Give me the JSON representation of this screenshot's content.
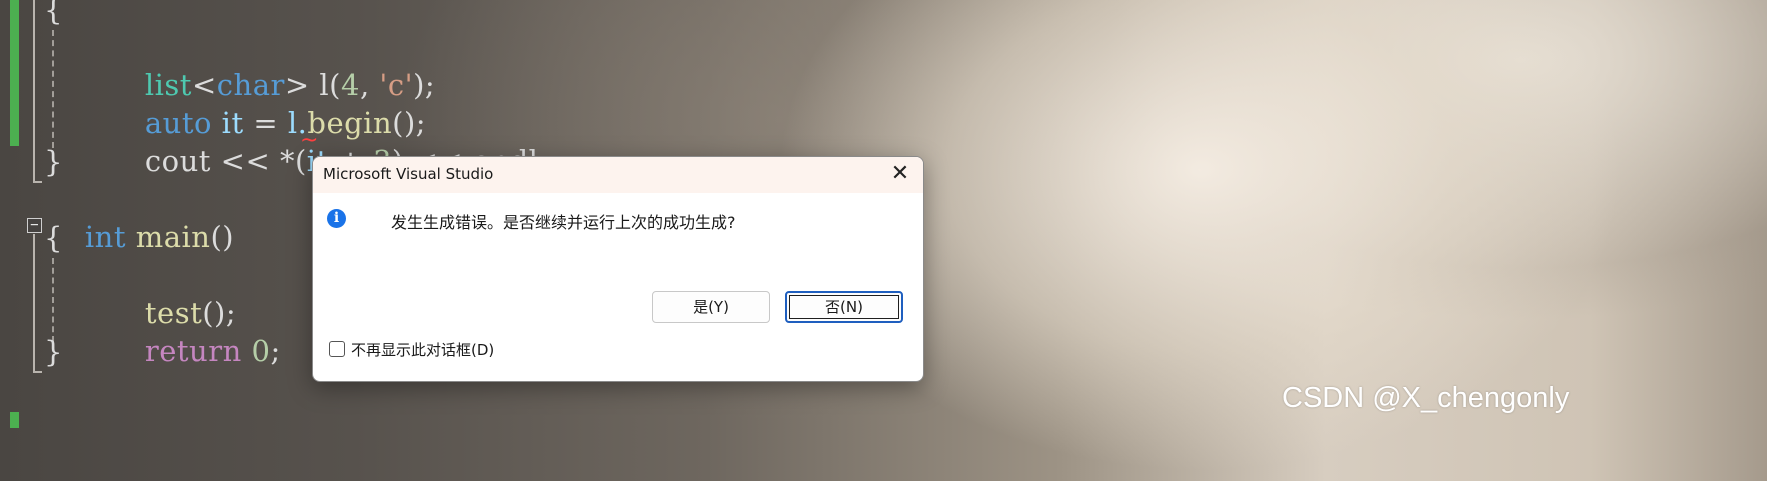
{
  "editor": {
    "lines": {
      "brace_open_1": "{",
      "l1_type": "list",
      "l1_lt": "<",
      "l1_targ": "char",
      "l1_gt": ">",
      "l1_rest_a": " l(",
      "l1_num": "4",
      "l1_comma": ", ",
      "l1_str": "'c'",
      "l1_end": ");",
      "l2_kw": "auto",
      "l2_id": " it",
      "l2_eq": " = ",
      "l2_l": "l.",
      "l2_fn": "begin",
      "l2_end": "();",
      "l3_cout": "cout",
      "l3_op1": " << *(",
      "l3_it": "it",
      "l3_plus": " + ",
      "l3_num": "3",
      "l3_op2": ") << ",
      "l3_endl": "endl",
      "l3_semi": ";",
      "brace_close_1": "}",
      "m_kw": "int",
      "m_fn": " main",
      "m_paren": "()",
      "brace_open_2": "{",
      "t_fn": "test",
      "t_end": "();",
      "r_kw": "return",
      "r_num": " 0",
      "r_semi": ";",
      "brace_close_2": "}"
    },
    "fold_glyph": "−",
    "error_squiggle": "~"
  },
  "dialog": {
    "title": "Microsoft Visual Studio",
    "close_glyph": "✕",
    "icon": "info-icon",
    "icon_glyph": "i",
    "message": "发生生成错误。是否继续并运行上次的成功生成?",
    "yes_label": "是(Y)",
    "no_label": "否(N)",
    "checkbox_label": "不再显示此对话框(D)",
    "checkbox_checked": false
  },
  "watermark": "CSDN @X_chengonly",
  "colors": {
    "gutter_change": "#4caf50",
    "keyword": "#569cd6",
    "control_keyword": "#c586c0",
    "function": "#dcdcaa",
    "type": "#4ec9b0",
    "number": "#b5cea8",
    "string": "#d69d85",
    "dialog_accent": "#1f5fbf"
  }
}
